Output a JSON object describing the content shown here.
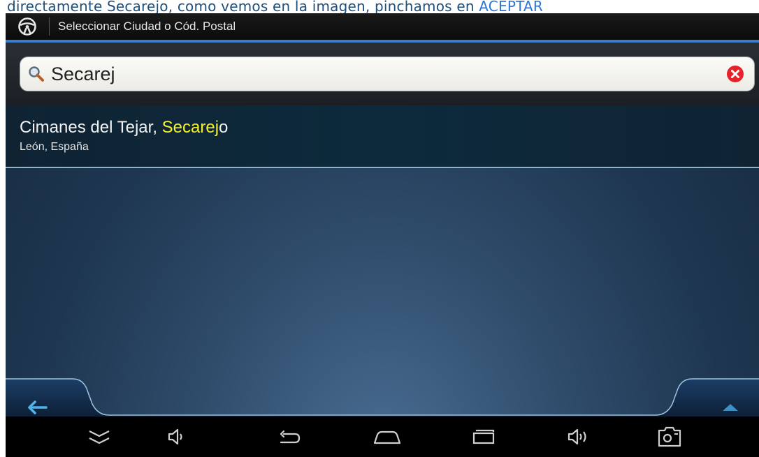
{
  "caption": {
    "text": "directamente Secarejo, como vemos en la imagen, pinchamos en ",
    "link": "ACEPTAR"
  },
  "titlebar": {
    "title": "Seleccionar Ciudad o Cód. Postal",
    "icon": "steering-wheel-icon"
  },
  "search": {
    "value": "Secarej",
    "icon": "search-icon",
    "clear_icon": "clear-icon"
  },
  "results": [
    {
      "name_prefix": "Cimanes del Tejar, ",
      "name_match": "Secarej",
      "name_suffix": "o",
      "region": "León, España"
    }
  ],
  "colors": {
    "accent": "#3b7bc8",
    "highlight": "#f3f22a",
    "clear": "#e8202a",
    "arrow": "#4fb3e8"
  },
  "navbar": {
    "items": [
      "collapse-icon",
      "volume-down-icon",
      "back-icon",
      "home-icon",
      "recent-apps-icon",
      "volume-up-icon",
      "screenshot-icon"
    ]
  }
}
